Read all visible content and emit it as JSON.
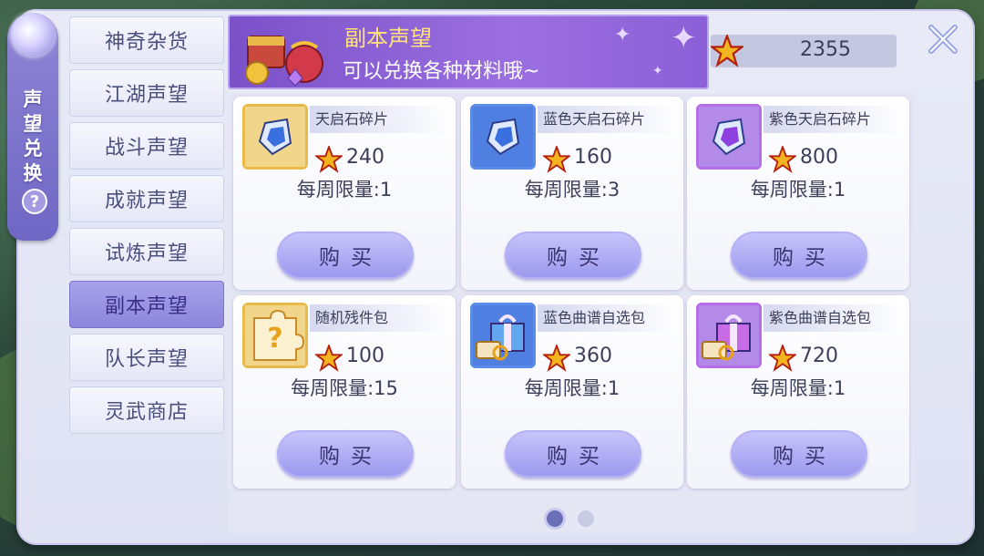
{
  "side_tab": {
    "title": "声望兑换",
    "help": "?"
  },
  "categories": [
    {
      "label": "神奇杂货",
      "active": false
    },
    {
      "label": "江湖声望",
      "active": false
    },
    {
      "label": "战斗声望",
      "active": false
    },
    {
      "label": "成就声望",
      "active": false
    },
    {
      "label": "试炼声望",
      "active": false
    },
    {
      "label": "副本声望",
      "active": true
    },
    {
      "label": "队长声望",
      "active": false
    },
    {
      "label": "灵武商店",
      "active": false
    }
  ],
  "banner": {
    "title": "副本声望",
    "subtitle": "可以兑换各种材料哦~"
  },
  "currency": {
    "value": "2355",
    "icon": "star-icon"
  },
  "items": [
    {
      "name": "天启石碎片",
      "price": "240",
      "limit": "每周限量:1",
      "buy": "购买",
      "icon": "crystal-fragment-icon",
      "color": "#e9b94a"
    },
    {
      "name": "蓝色天启石碎片",
      "price": "160",
      "limit": "每周限量:3",
      "buy": "购买",
      "icon": "blue-crystal-fragment-icon",
      "color": "#5b8de8"
    },
    {
      "name": "紫色天启石碎片",
      "price": "800",
      "limit": "每周限量:1",
      "buy": "购买",
      "icon": "purple-crystal-fragment-icon",
      "color": "#b36ee8"
    },
    {
      "name": "随机残件包",
      "price": "100",
      "limit": "每周限量:15",
      "buy": "购买",
      "icon": "puzzle-pack-icon",
      "color": "#e9b94a"
    },
    {
      "name": "蓝色曲谱自选包",
      "price": "360",
      "limit": "每周限量:1",
      "buy": "购买",
      "icon": "blue-gift-box-icon",
      "color": "#5b8de8"
    },
    {
      "name": "紫色曲谱自选包",
      "price": "720",
      "limit": "每周限量:1",
      "buy": "购买",
      "icon": "purple-gift-box-icon",
      "color": "#b36ee8"
    }
  ],
  "pagination": {
    "pages": 2,
    "current": 1
  }
}
